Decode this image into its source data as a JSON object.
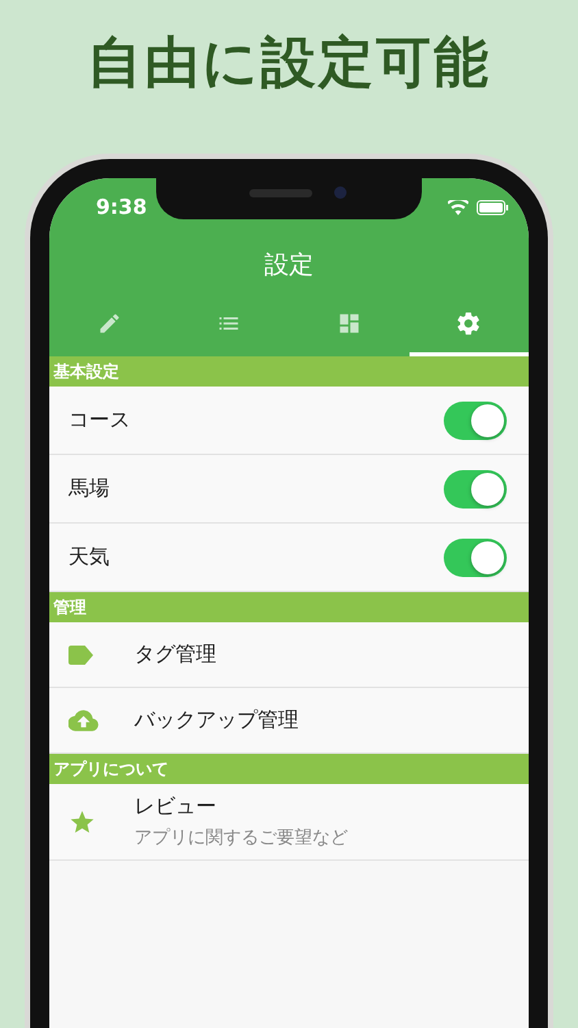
{
  "headline": "自由に設定可能",
  "status_bar": {
    "time": "9:38"
  },
  "title": "設定",
  "tabs": [
    {
      "selected": false
    },
    {
      "selected": false
    },
    {
      "selected": false
    },
    {
      "selected": true
    }
  ],
  "sections": [
    {
      "title": "基本設定",
      "items": [
        {
          "kind": "toggle",
          "label": "コース",
          "on": true
        },
        {
          "kind": "toggle",
          "label": "馬場",
          "on": true
        },
        {
          "kind": "toggle",
          "label": "天気",
          "on": true
        }
      ]
    },
    {
      "title": "管理",
      "items": [
        {
          "kind": "link",
          "label": "タグ管理"
        },
        {
          "kind": "link",
          "label": "バックアップ管理"
        }
      ]
    },
    {
      "title": "アプリについて",
      "items": [
        {
          "kind": "link",
          "label": "レビュー",
          "sublabel": "アプリに関するご要望など"
        }
      ]
    }
  ]
}
